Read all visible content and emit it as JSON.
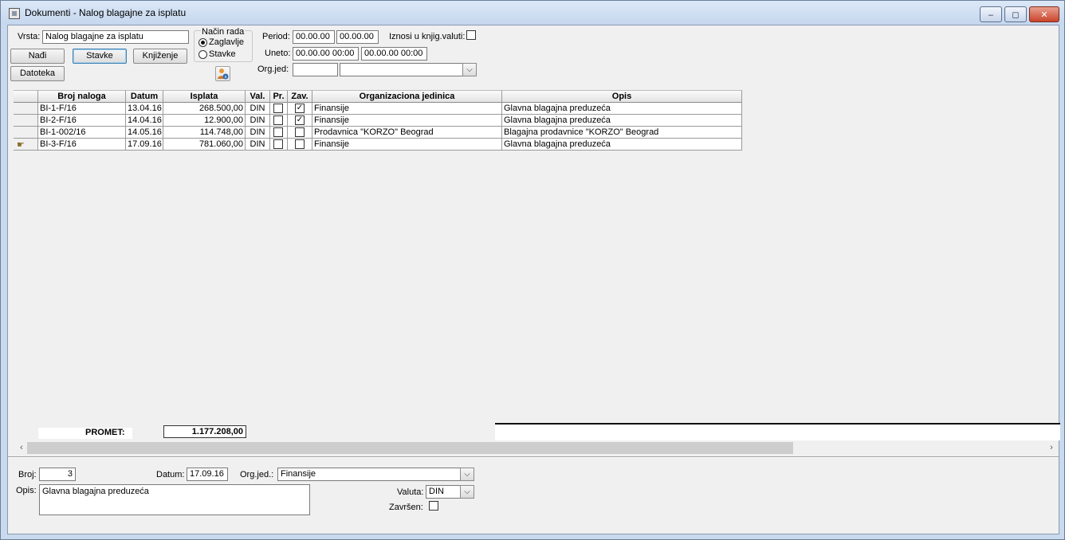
{
  "window": {
    "title": "Dokumenti - Nalog blagajne za isplatu",
    "minimize": "‒",
    "maximize": "◻",
    "close": "✕"
  },
  "filter": {
    "vrsta_label": "Vrsta:",
    "vrsta_value": "Nalog blagajne za isplatu",
    "nadji": "Nađi",
    "stavke_btn": "Stavke",
    "knjizenje": "Knjiženje",
    "datoteka": "Datoteka",
    "nacin_rada_label": "Način rada",
    "radio_zaglavlje": "Zaglavlje",
    "radio_stavke": "Stavke",
    "period_label": "Period:",
    "period_from": "00.00.00",
    "period_to": "00.00.00",
    "uneto_label": "Uneto:",
    "uneto_from": "00.00.00 00:00",
    "uneto_to": "00.00.00 00:00",
    "orgjed_label": "Org.jed:",
    "orgjed_code": "",
    "orgjed_name": "",
    "iznosi_label": "Iznosi u knjig.valuti:"
  },
  "grid": {
    "columns": [
      "Broj naloga",
      "Datum",
      "Isplata",
      "Val.",
      "Pr.",
      "Zav.",
      "Organizaciona jedinica",
      "Opis"
    ],
    "rows": [
      {
        "broj": "BI-1-F/16",
        "datum": "13.04.16",
        "isplata": "268.500,00",
        "val": "DIN",
        "pr": false,
        "zav": true,
        "org": "Finansije",
        "opis": "Glavna blagajna preduzeća"
      },
      {
        "broj": "BI-2-F/16",
        "datum": "14.04.16",
        "isplata": "12.900,00",
        "val": "DIN",
        "pr": false,
        "zav": true,
        "org": "Finansije",
        "opis": "Glavna blagajna preduzeća"
      },
      {
        "broj": "BI-1-002/16",
        "datum": "14.05.16",
        "isplata": "114.748,00",
        "val": "DIN",
        "pr": false,
        "zav": false,
        "org": "Prodavnica \"KORZO\" Beograd",
        "opis": "Blagajna prodavnice \"KORZO\" Beograd"
      },
      {
        "broj": "BI-3-F/16",
        "datum": "17.09.16",
        "isplata": "781.060,00",
        "val": "DIN",
        "pr": false,
        "zav": false,
        "org": "Finansije",
        "opis": "Glavna blagajna preduzeća"
      }
    ],
    "promet_label": "PROMET:",
    "promet_value": "1.177.208,00"
  },
  "detail": {
    "broj_label": "Broj:",
    "broj_value": "3",
    "datum_label": "Datum:",
    "datum_value": "17.09.16",
    "orgjed_label": "Org.jed.:",
    "orgjed_value": "Finansije",
    "opis_label": "Opis:",
    "opis_value": "Glavna blagajna preduzeća",
    "valuta_label": "Valuta:",
    "valuta_value": "DIN",
    "zavrsen_label": "Završen:"
  }
}
